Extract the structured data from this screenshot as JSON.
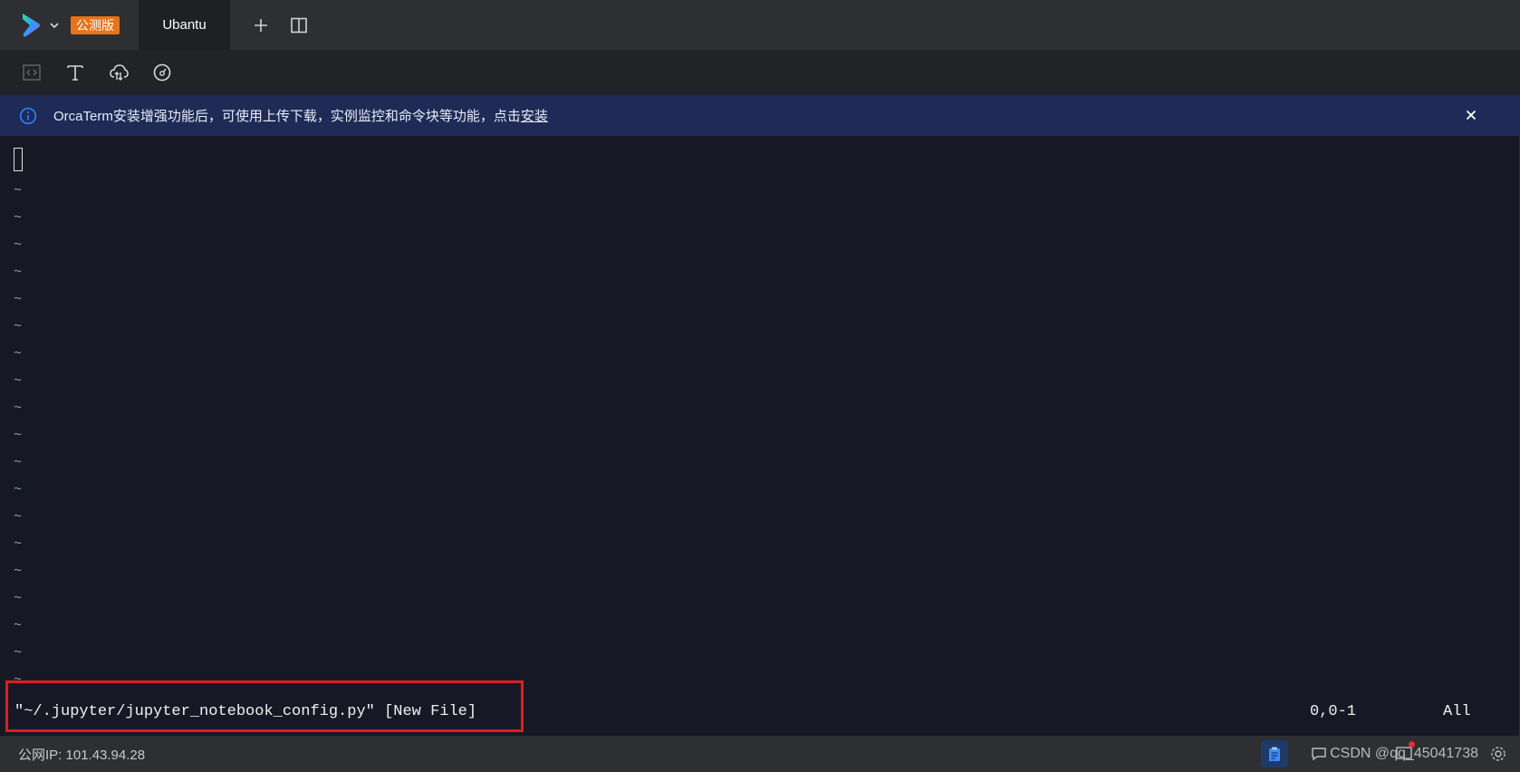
{
  "app": {
    "beta_badge": "公测版",
    "tab_title": "Ubantu"
  },
  "banner": {
    "text": "OrcaTerm安装增强功能后，可使用上传下载，实例监控和命令块等功能，点击",
    "link": "安装"
  },
  "terminal": {
    "tilde_lines": [
      "~",
      "~",
      "~",
      "~",
      "~",
      "~",
      "~",
      "~",
      "~",
      "~",
      "~",
      "~",
      "~",
      "~",
      "~",
      "~",
      "~",
      "~",
      "~"
    ],
    "status_message": "\"~/.jupyter/jupyter_notebook_config.py\" [New File]",
    "cursor_position": "0,0-1",
    "scroll_indicator": "All"
  },
  "bottom": {
    "public_ip": "公网IP: 101.43.94.28",
    "watermark": "CSDN @qq_45041738"
  },
  "colors": {
    "terminal_bg": "#161925",
    "banner_bg": "#1f2b56",
    "highlight_box": "#e01d1d",
    "beta_badge": "#e8731a"
  }
}
